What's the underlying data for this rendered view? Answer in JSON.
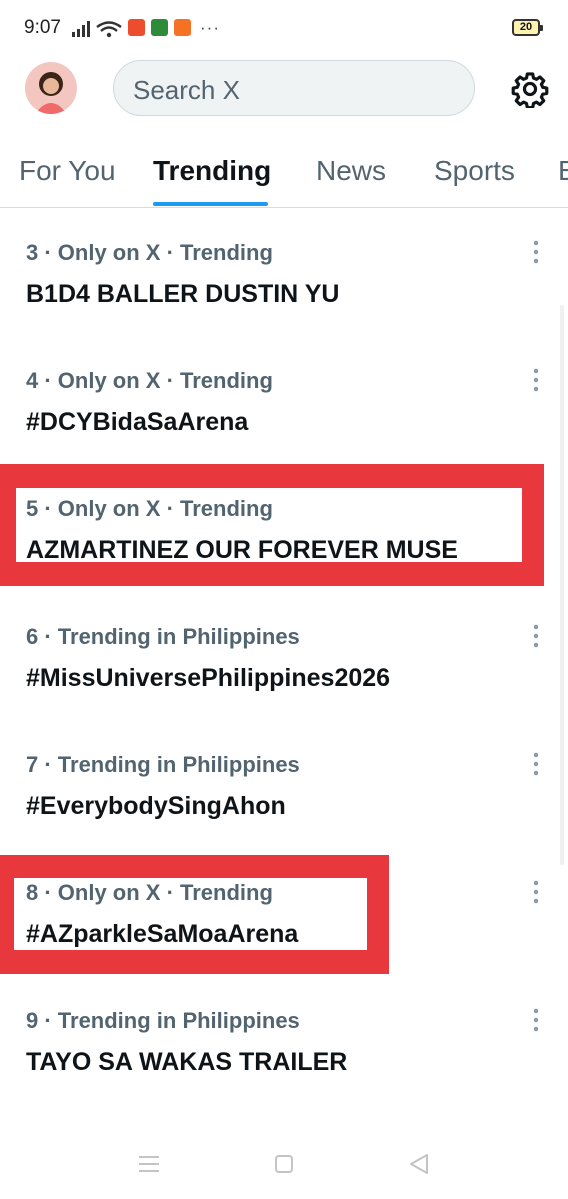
{
  "status_bar": {
    "time": "9:07",
    "battery": "20",
    "more": "···"
  },
  "search": {
    "placeholder": "Search X"
  },
  "tabs": [
    {
      "label": "For You",
      "active": false
    },
    {
      "label": "Trending",
      "active": true
    },
    {
      "label": "News",
      "active": false
    },
    {
      "label": "Sports",
      "active": false
    },
    {
      "label": "E",
      "active": false
    }
  ],
  "trends": [
    {
      "meta": "3 · Only on X · Trending",
      "title": "B1D4 BALLER DUSTIN YU"
    },
    {
      "meta": "4 · Only on X · Trending",
      "title": "#DCYBidaSaArena"
    },
    {
      "meta": "5 · Only on X · Trending",
      "title": "AZMARTINEZ OUR FOREVER MUSE",
      "highlighted": true
    },
    {
      "meta": "6 · Trending in Philippines",
      "title": "#MissUniversePhilippines2026"
    },
    {
      "meta": "7 · Trending in Philippines",
      "title": "#EverybodySingAhon"
    },
    {
      "meta": "8 · Only on X · Trending",
      "title": "#AZparkleSaMoaArena",
      "highlighted": true
    },
    {
      "meta": "9 · Trending in Philippines",
      "title": "TAYO SA WAKAS TRAILER"
    }
  ],
  "colors": {
    "accent": "#1d9bf0",
    "highlight": "#e8383d",
    "secondary_text": "#536471",
    "primary_text": "#0f1419"
  },
  "icons": {
    "settings": "gear-icon",
    "more": "more-vertical-icon",
    "nav_menu": "menu-icon",
    "nav_home": "home-square-icon",
    "nav_back": "back-triangle-icon"
  }
}
